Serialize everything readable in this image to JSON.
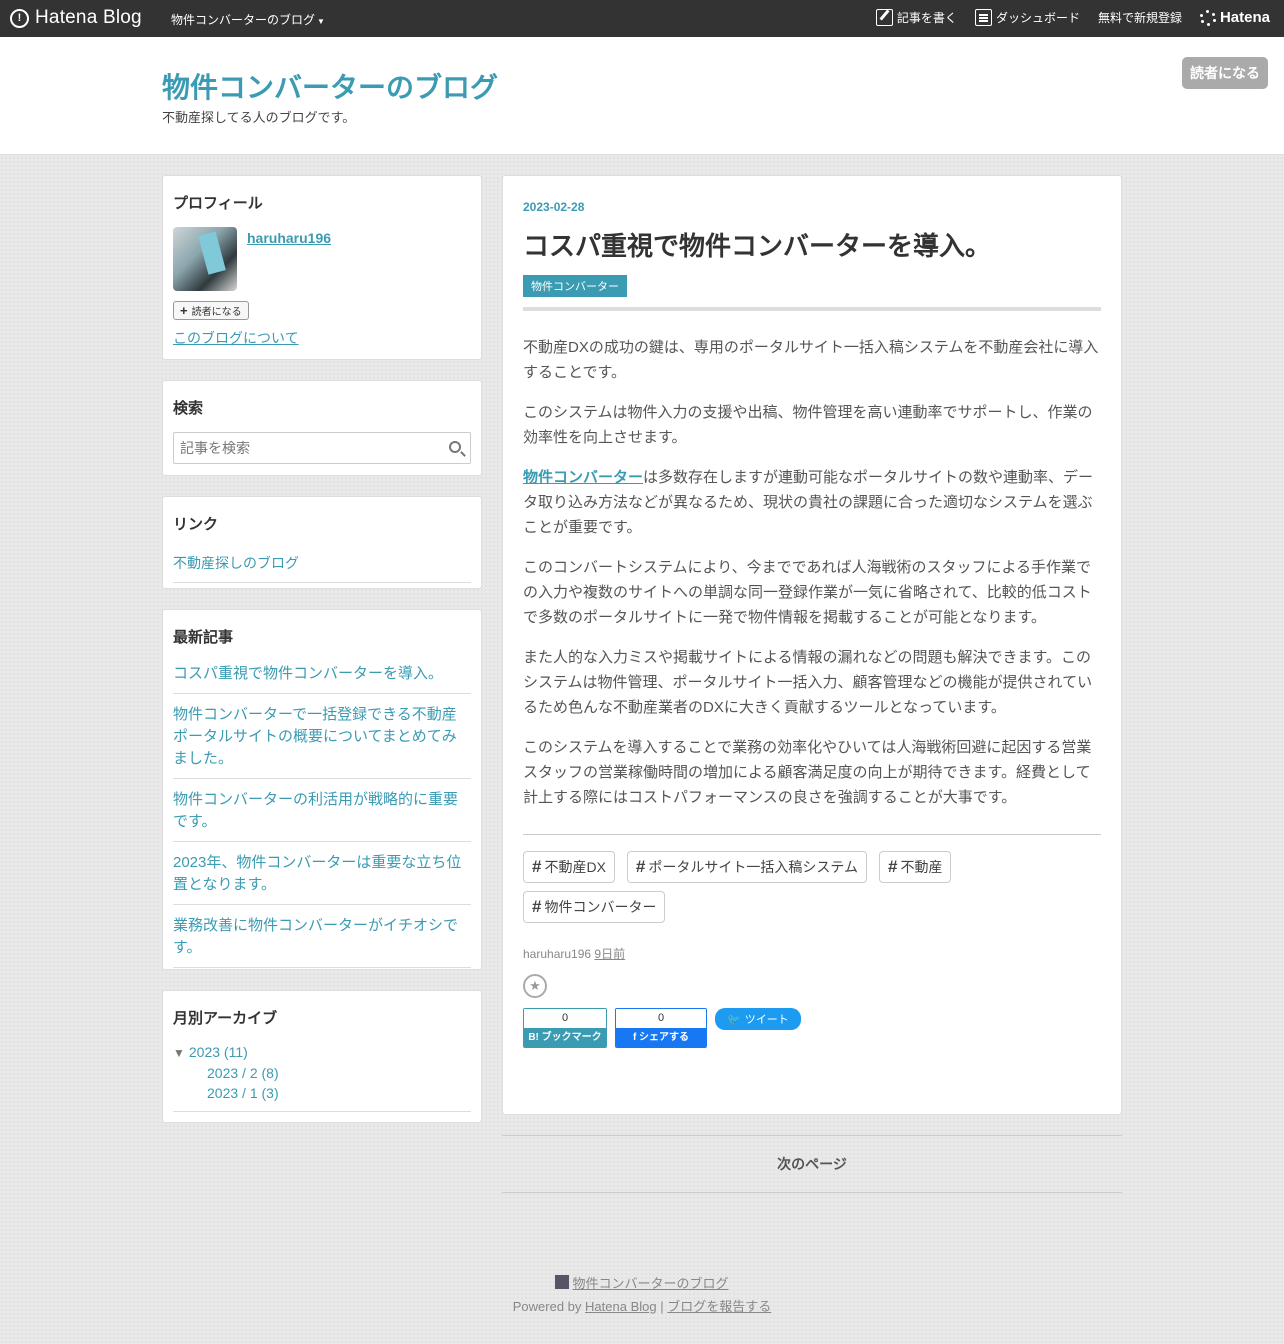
{
  "topbar": {
    "logo": "Hatena Blog",
    "blog_menu": "物件コンバーターのブログ",
    "write": "記事を書く",
    "dashboard": "ダッシュボード",
    "register": "無料で新規登録",
    "hatena": "Hatena"
  },
  "header": {
    "title": "物件コンバーターのブログ",
    "description": "不動産探してる人のブログです。",
    "subscribe": "読者になる"
  },
  "sidebar": {
    "profile": {
      "heading": "プロフィール",
      "name": "haruharu196",
      "subscribe": "読者になる",
      "about": "このブログについて"
    },
    "search": {
      "heading": "検索",
      "placeholder": "記事を検索"
    },
    "links": {
      "heading": "リンク",
      "items": [
        "不動産探しのブログ"
      ]
    },
    "recent": {
      "heading": "最新記事",
      "items": [
        "コスパ重視で物件コンバーターを導入。",
        "物件コンバーターで一括登録できる不動産ポータルサイトの概要についてまとめてみました。",
        "物件コンバーターの利活用が戦略的に重要です。",
        "2023年、物件コンバーターは重要な立ち位置となります。",
        "業務改善に物件コンバーターがイチオシです。"
      ]
    },
    "archive": {
      "heading": "月別アーカイブ",
      "year": "2023 (11)",
      "months": [
        "2023 / 2 (8)",
        "2023 / 1 (3)"
      ]
    }
  },
  "article": {
    "date": "2023-02-28",
    "title": "コスパ重視で物件コンバーターを導入。",
    "category": "物件コンバーター",
    "p1": "不動産DXの成功の鍵は、専用のポータルサイト一括入稿システムを不動産会社に導入することです。",
    "p2": "このシステムは物件入力の支援や出稿、物件管理を高い連動率でサポートし、作業の効率性を向上させます。",
    "p3_link": "物件コンバーター",
    "p3_rest": "は多数存在しますが連動可能なポータルサイトの数や連動率、データ取り込み方法などが異なるため、現状の貴社の課題に合った適切なシステムを選ぶことが重要です。",
    "p4": "このコンバートシステムにより、今までであれば人海戦術のスタッフによる手作業での入力や複数のサイトへの単調な同一登録作業が一気に省略されて、比較的低コストで多数のポータルサイトに一発で物件情報を掲載することが可能となります。",
    "p5": "また人的な入力ミスや掲載サイトによる情報の漏れなどの問題も解決できます。このシステムは物件管理、ポータルサイト一括入力、顧客管理などの機能が提供されているため色んな不動産業者のDXに大きく貢献するツールとなっています。",
    "p6": "このシステムを導入することで業務の効率化やひいては人海戦術回避に起因する営業スタッフの営業稼働時間の増加による顧客満足度の向上が期待できます。経費として計上する際にはコストパフォーマンスの良さを強調することが大事です。",
    "tags": [
      "不動産DX",
      "ポータルサイト一括入稿システム",
      "不動産",
      "物件コンバーター"
    ],
    "author": "haruharu196",
    "ago": "9日前",
    "bookmark_count": "0",
    "bookmark_label": "B! ブックマーク",
    "share_count": "0",
    "share_label": "f シェアする",
    "tweet_label": "ツイート"
  },
  "pager": {
    "next": "次のページ"
  },
  "footer": {
    "blog_name": "物件コンバーターのブログ",
    "powered": "Powered by",
    "hatena_blog": "Hatena Blog",
    "sep": "|",
    "report": "ブログを報告する"
  },
  "colors": {
    "accent": "#3a9bb3",
    "topbar": "#333333"
  }
}
